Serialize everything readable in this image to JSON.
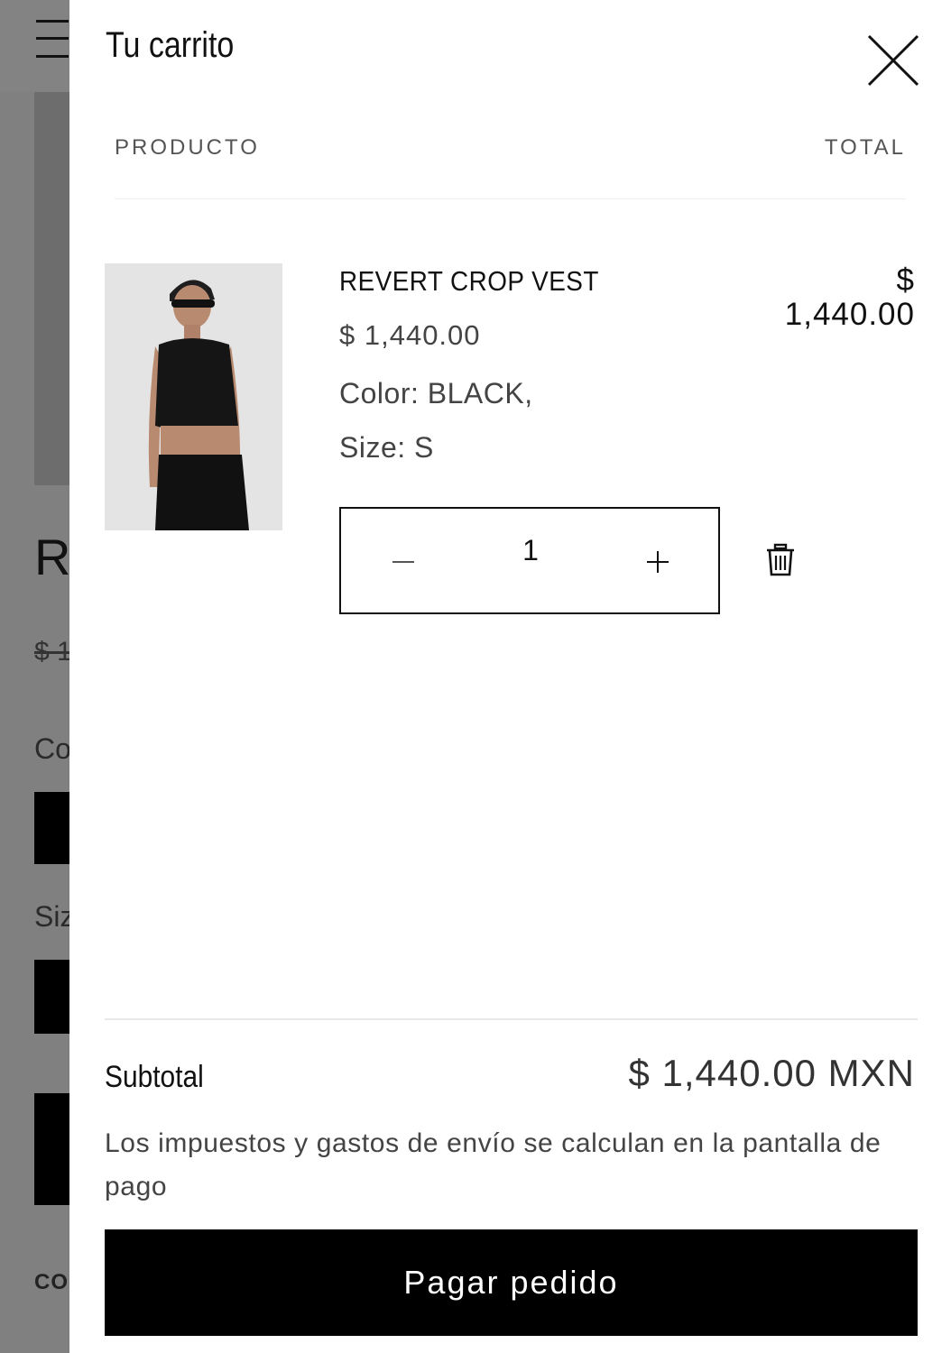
{
  "background_page": {
    "title_fragment": "R",
    "price_fragment": "$ 1",
    "color_label_fragment": "Co",
    "size_label_fragment": "Siz",
    "small_label_fragment": "CO"
  },
  "drawer": {
    "title": "Tu carrito",
    "close_icon": "close-icon",
    "columns": {
      "product": "PRODUCTO",
      "total": "TOTAL"
    },
    "items": [
      {
        "name": "REVERT CROP VEST",
        "price": "$ 1,440.00",
        "color": "Color: BLACK,",
        "size": "Size: S",
        "quantity": "1",
        "line_total_currency": "$",
        "line_total_amount": "1,440.00",
        "image_icon": "product-photo",
        "remove_icon": "trash-icon"
      }
    ],
    "footer": {
      "subtotal_label": "Subtotal",
      "subtotal_value": "$ 1,440.00 MXN",
      "tax_note": "Los impuestos y gastos de envío se calculan en la pantalla de pago",
      "checkout_label": "Pagar pedido"
    }
  },
  "colors": {
    "overlay": "#808080",
    "button_bg": "#000000",
    "button_text": "#ffffff",
    "product_image_bg": "#e4e4e4"
  }
}
